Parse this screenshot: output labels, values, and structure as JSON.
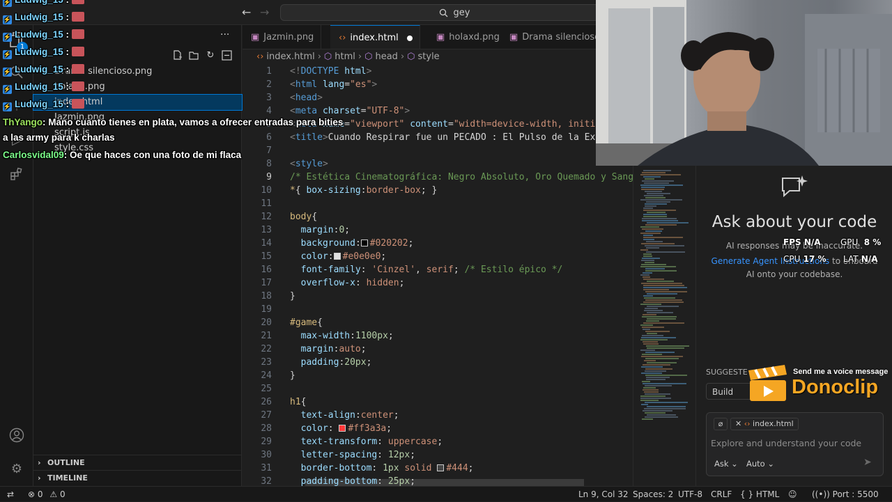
{
  "titlebar": {
    "search_text": "gey"
  },
  "sidebar": {
    "files": [
      {
        "label": "Drama silencioso.png",
        "selected": false
      },
      {
        "label": "holaxd.png",
        "selected": false
      },
      {
        "label": "index.html",
        "selected": true
      },
      {
        "label": "Jazmin.png",
        "selected": false
      },
      {
        "label": "script.js",
        "selected": false
      },
      {
        "label": "style.css",
        "selected": false
      }
    ],
    "outline_label": "OUTLINE",
    "timeline_label": "TIMELINE",
    "badge_count": "1"
  },
  "tabs": [
    {
      "label": "Jazmin.png",
      "active": false,
      "dirty": false
    },
    {
      "label": "index.html",
      "active": true,
      "dirty": true
    },
    {
      "label": "holaxd.png",
      "active": false,
      "dirty": false
    },
    {
      "label": "Drama silencioso.png",
      "active": false,
      "dirty": false
    }
  ],
  "breadcrumb": [
    "index.html",
    "html",
    "head",
    "style"
  ],
  "editor": {
    "current_line": 9,
    "lines": [
      {
        "n": "1",
        "parts": [
          [
            "t-punc",
            "<!"
          ],
          [
            "t-tag",
            "DOCTYPE"
          ],
          [
            "t-attr",
            " html"
          ],
          [
            "t-punc",
            ">"
          ]
        ]
      },
      {
        "n": "2",
        "parts": [
          [
            "t-punc",
            "<"
          ],
          [
            "t-tag",
            "html"
          ],
          [
            "t-attr",
            " lang"
          ],
          [
            "",
            "="
          ],
          [
            "t-str",
            "\"es\""
          ],
          [
            "t-punc",
            ">"
          ]
        ]
      },
      {
        "n": "3",
        "parts": [
          [
            "t-punc",
            "<"
          ],
          [
            "t-tag",
            "head"
          ],
          [
            "t-punc",
            ">"
          ]
        ]
      },
      {
        "n": "4",
        "parts": [
          [
            "t-punc",
            "<"
          ],
          [
            "t-tag",
            "meta"
          ],
          [
            "t-attr",
            " charset"
          ],
          [
            "",
            "="
          ],
          [
            "t-str",
            "\"UTF-8\""
          ],
          [
            "t-punc",
            ">"
          ]
        ]
      },
      {
        "n": "5",
        "parts": [
          [
            "t-punc",
            "<"
          ],
          [
            "t-tag",
            "meta"
          ],
          [
            "t-attr",
            " name"
          ],
          [
            "",
            "="
          ],
          [
            "t-str",
            "\"viewport\""
          ],
          [
            "t-attr",
            " content"
          ],
          [
            "",
            "="
          ],
          [
            "t-str",
            "\"width=device-width, initia"
          ]
        ]
      },
      {
        "n": "6",
        "parts": [
          [
            "t-punc",
            "<"
          ],
          [
            "t-tag",
            "title"
          ],
          [
            "t-punc",
            ">"
          ],
          [
            "",
            "Cuando Respirar fue un PECADO : El Pulso de la Ext"
          ]
        ]
      },
      {
        "n": "7",
        "parts": []
      },
      {
        "n": "8",
        "parts": [
          [
            "t-punc",
            "<"
          ],
          [
            "t-tag",
            "style"
          ],
          [
            "t-punc",
            ">"
          ]
        ]
      },
      {
        "n": "9",
        "parts": [
          [
            "t-com",
            "/* Estética Cinematográfica: Negro Absoluto, Oro Quemado y Sangr"
          ]
        ]
      },
      {
        "n": "10",
        "parts": [
          [
            "t-sel",
            "*"
          ],
          [
            "",
            "{ "
          ],
          [
            "t-prop",
            "box-sizing"
          ],
          [
            "",
            ":"
          ],
          [
            "t-val",
            "border-box"
          ],
          [
            "",
            "; }"
          ]
        ]
      },
      {
        "n": "11",
        "parts": []
      },
      {
        "n": "12",
        "parts": [
          [
            "t-sel",
            "body"
          ],
          [
            "",
            "{"
          ]
        ]
      },
      {
        "n": "13",
        "parts": [
          [
            "",
            "  "
          ],
          [
            "t-prop",
            "margin"
          ],
          [
            "",
            ":"
          ],
          [
            "t-num",
            "0"
          ],
          [
            "",
            ";"
          ]
        ]
      },
      {
        "n": "14",
        "parts": [
          [
            "",
            "  "
          ],
          [
            "t-prop",
            "background"
          ],
          [
            "",
            ":"
          ],
          [
            "swatch:#020202",
            ""
          ],
          [
            "t-val",
            "#020202"
          ],
          [
            "",
            ";"
          ]
        ]
      },
      {
        "n": "15",
        "parts": [
          [
            "",
            "  "
          ],
          [
            "t-prop",
            "color"
          ],
          [
            "",
            ":"
          ],
          [
            "swatch:#e0e0e0",
            ""
          ],
          [
            "t-val",
            "#e0e0e0"
          ],
          [
            "",
            ";"
          ]
        ]
      },
      {
        "n": "16",
        "parts": [
          [
            "",
            "  "
          ],
          [
            "t-prop",
            "font-family"
          ],
          [
            "",
            ": "
          ],
          [
            "t-val",
            "'Cinzel'"
          ],
          [
            "",
            ", "
          ],
          [
            "t-val",
            "serif"
          ],
          [
            "",
            "; "
          ],
          [
            "t-com",
            "/* Estilo épico */"
          ]
        ]
      },
      {
        "n": "17",
        "parts": [
          [
            "",
            "  "
          ],
          [
            "t-prop",
            "overflow-x"
          ],
          [
            "",
            ": "
          ],
          [
            "t-val",
            "hidden"
          ],
          [
            "",
            ";"
          ]
        ]
      },
      {
        "n": "18",
        "parts": [
          [
            "",
            "}"
          ]
        ]
      },
      {
        "n": "19",
        "parts": []
      },
      {
        "n": "20",
        "parts": [
          [
            "t-sel",
            "#game"
          ],
          [
            "",
            "{"
          ]
        ]
      },
      {
        "n": "21",
        "parts": [
          [
            "",
            "  "
          ],
          [
            "t-prop",
            "max-width"
          ],
          [
            "",
            ":"
          ],
          [
            "t-num",
            "1100px"
          ],
          [
            "",
            ";"
          ]
        ]
      },
      {
        "n": "22",
        "parts": [
          [
            "",
            "  "
          ],
          [
            "t-prop",
            "margin"
          ],
          [
            "",
            ":"
          ],
          [
            "t-val",
            "auto"
          ],
          [
            "",
            ";"
          ]
        ]
      },
      {
        "n": "23",
        "parts": [
          [
            "",
            "  "
          ],
          [
            "t-prop",
            "padding"
          ],
          [
            "",
            ":"
          ],
          [
            "t-num",
            "20px"
          ],
          [
            "",
            ";"
          ]
        ]
      },
      {
        "n": "24",
        "parts": [
          [
            "",
            "}"
          ]
        ]
      },
      {
        "n": "25",
        "parts": []
      },
      {
        "n": "26",
        "parts": [
          [
            "t-sel",
            "h1"
          ],
          [
            "",
            "{"
          ]
        ]
      },
      {
        "n": "27",
        "parts": [
          [
            "",
            "  "
          ],
          [
            "t-prop",
            "text-align"
          ],
          [
            "",
            ":"
          ],
          [
            "t-val",
            "center"
          ],
          [
            "",
            ";"
          ]
        ]
      },
      {
        "n": "28",
        "parts": [
          [
            "",
            "  "
          ],
          [
            "t-prop",
            "color"
          ],
          [
            "",
            ": "
          ],
          [
            "swatch:#ff3a3a",
            ""
          ],
          [
            "t-val",
            "#ff3a3a"
          ],
          [
            "",
            ";"
          ]
        ]
      },
      {
        "n": "29",
        "parts": [
          [
            "",
            "  "
          ],
          [
            "t-prop",
            "text-transform"
          ],
          [
            "",
            ": "
          ],
          [
            "t-val",
            "uppercase"
          ],
          [
            "",
            ";"
          ]
        ]
      },
      {
        "n": "30",
        "parts": [
          [
            "",
            "  "
          ],
          [
            "t-prop",
            "letter-spacing"
          ],
          [
            "",
            ": "
          ],
          [
            "t-num",
            "12px"
          ],
          [
            "",
            ";"
          ]
        ]
      },
      {
        "n": "31",
        "parts": [
          [
            "",
            "  "
          ],
          [
            "t-prop",
            "border-bottom"
          ],
          [
            "",
            ": "
          ],
          [
            "t-num",
            "1px"
          ],
          [
            "",
            " "
          ],
          [
            "t-val",
            "solid"
          ],
          [
            "",
            " "
          ],
          [
            "swatch:#444",
            ""
          ],
          [
            "t-val",
            "#444"
          ],
          [
            "",
            ";"
          ]
        ]
      },
      {
        "n": "32",
        "parts": [
          [
            "",
            "  "
          ],
          [
            "t-prop",
            "padding-bottom"
          ],
          [
            "",
            ": "
          ],
          [
            "t-num",
            "25px"
          ],
          [
            "",
            ";"
          ]
        ]
      }
    ]
  },
  "chat_panel": {
    "title": "Ask about your code",
    "disclaimer": "AI responses may be inaccurate.",
    "link": "Generate Agent Instructions",
    "link_suffix": "to onboard",
    "line2": "AI onto your codebase.",
    "suggested_label": "SUGGESTE",
    "suggested_chip": "Build We",
    "context_chip": "index.html",
    "input_placeholder": "Explore and understand your code",
    "mode_ask": "Ask",
    "mode_auto": "Auto"
  },
  "stats": {
    "fps_label": "FPS",
    "fps_val": "N/A",
    "gpu_label": "GPU",
    "gpu_val": "8 %",
    "cpu_label": "CPU",
    "cpu_val": "17 %",
    "lat_label": "LAT",
    "lat_val": "N/A"
  },
  "chat_overlay": {
    "repeated_user": "Ludwig_15",
    "repeated_count": 7,
    "messages": [
      {
        "user": "ThYango",
        "text": ": Mano cuanto tienes en plata, vamos a ofrecer entradas para bities"
      },
      {
        "user": "",
        "text": "a las army para k charlas"
      },
      {
        "user": "Carlosvidal09",
        "text": ": Oe que haces con una foto de mi flaca"
      }
    ]
  },
  "donoclip": {
    "tagline": "Send me a voice message",
    "brand": "Donoclip"
  },
  "statusbar": {
    "errors": "0",
    "warnings": "0",
    "position": "Ln 9, Col 32",
    "spaces": "Spaces: 2",
    "encoding": "UTF-8",
    "eol": "CRLF",
    "language": "HTML",
    "port": "Port : 5500"
  },
  "colors": {
    "accent": "#0078d4",
    "brand_donoclip": "#f5a623"
  }
}
